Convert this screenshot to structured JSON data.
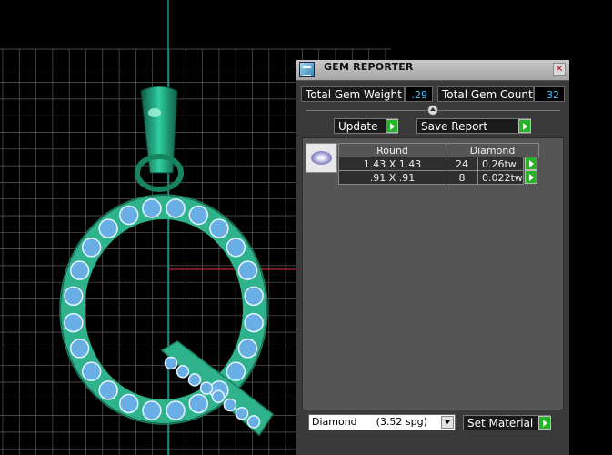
{
  "panel": {
    "title": "GEM REPORTER",
    "total_gem_weight_label": "Total Gem Weight",
    "total_gem_weight_value": ".29",
    "total_gem_count_label": "Total Gem Count",
    "total_gem_count_value": "32",
    "update_label": "Update",
    "save_report_label": "Save Report",
    "table": {
      "headers": [
        "Round",
        "Diamond"
      ],
      "rows": [
        {
          "size": "1.43 X 1.43",
          "count": "24",
          "carat": "0.26tw"
        },
        {
          "size": ".91 X .91",
          "count": "8",
          "carat": "0.022tw"
        }
      ]
    },
    "material_value": "Diamond      (3.52 spg)",
    "set_material_label": "Set Material"
  },
  "viewport": {
    "object": "pendant-letter-q",
    "metal_color": "#2fb38c",
    "gem_color": "#6aaee6"
  }
}
